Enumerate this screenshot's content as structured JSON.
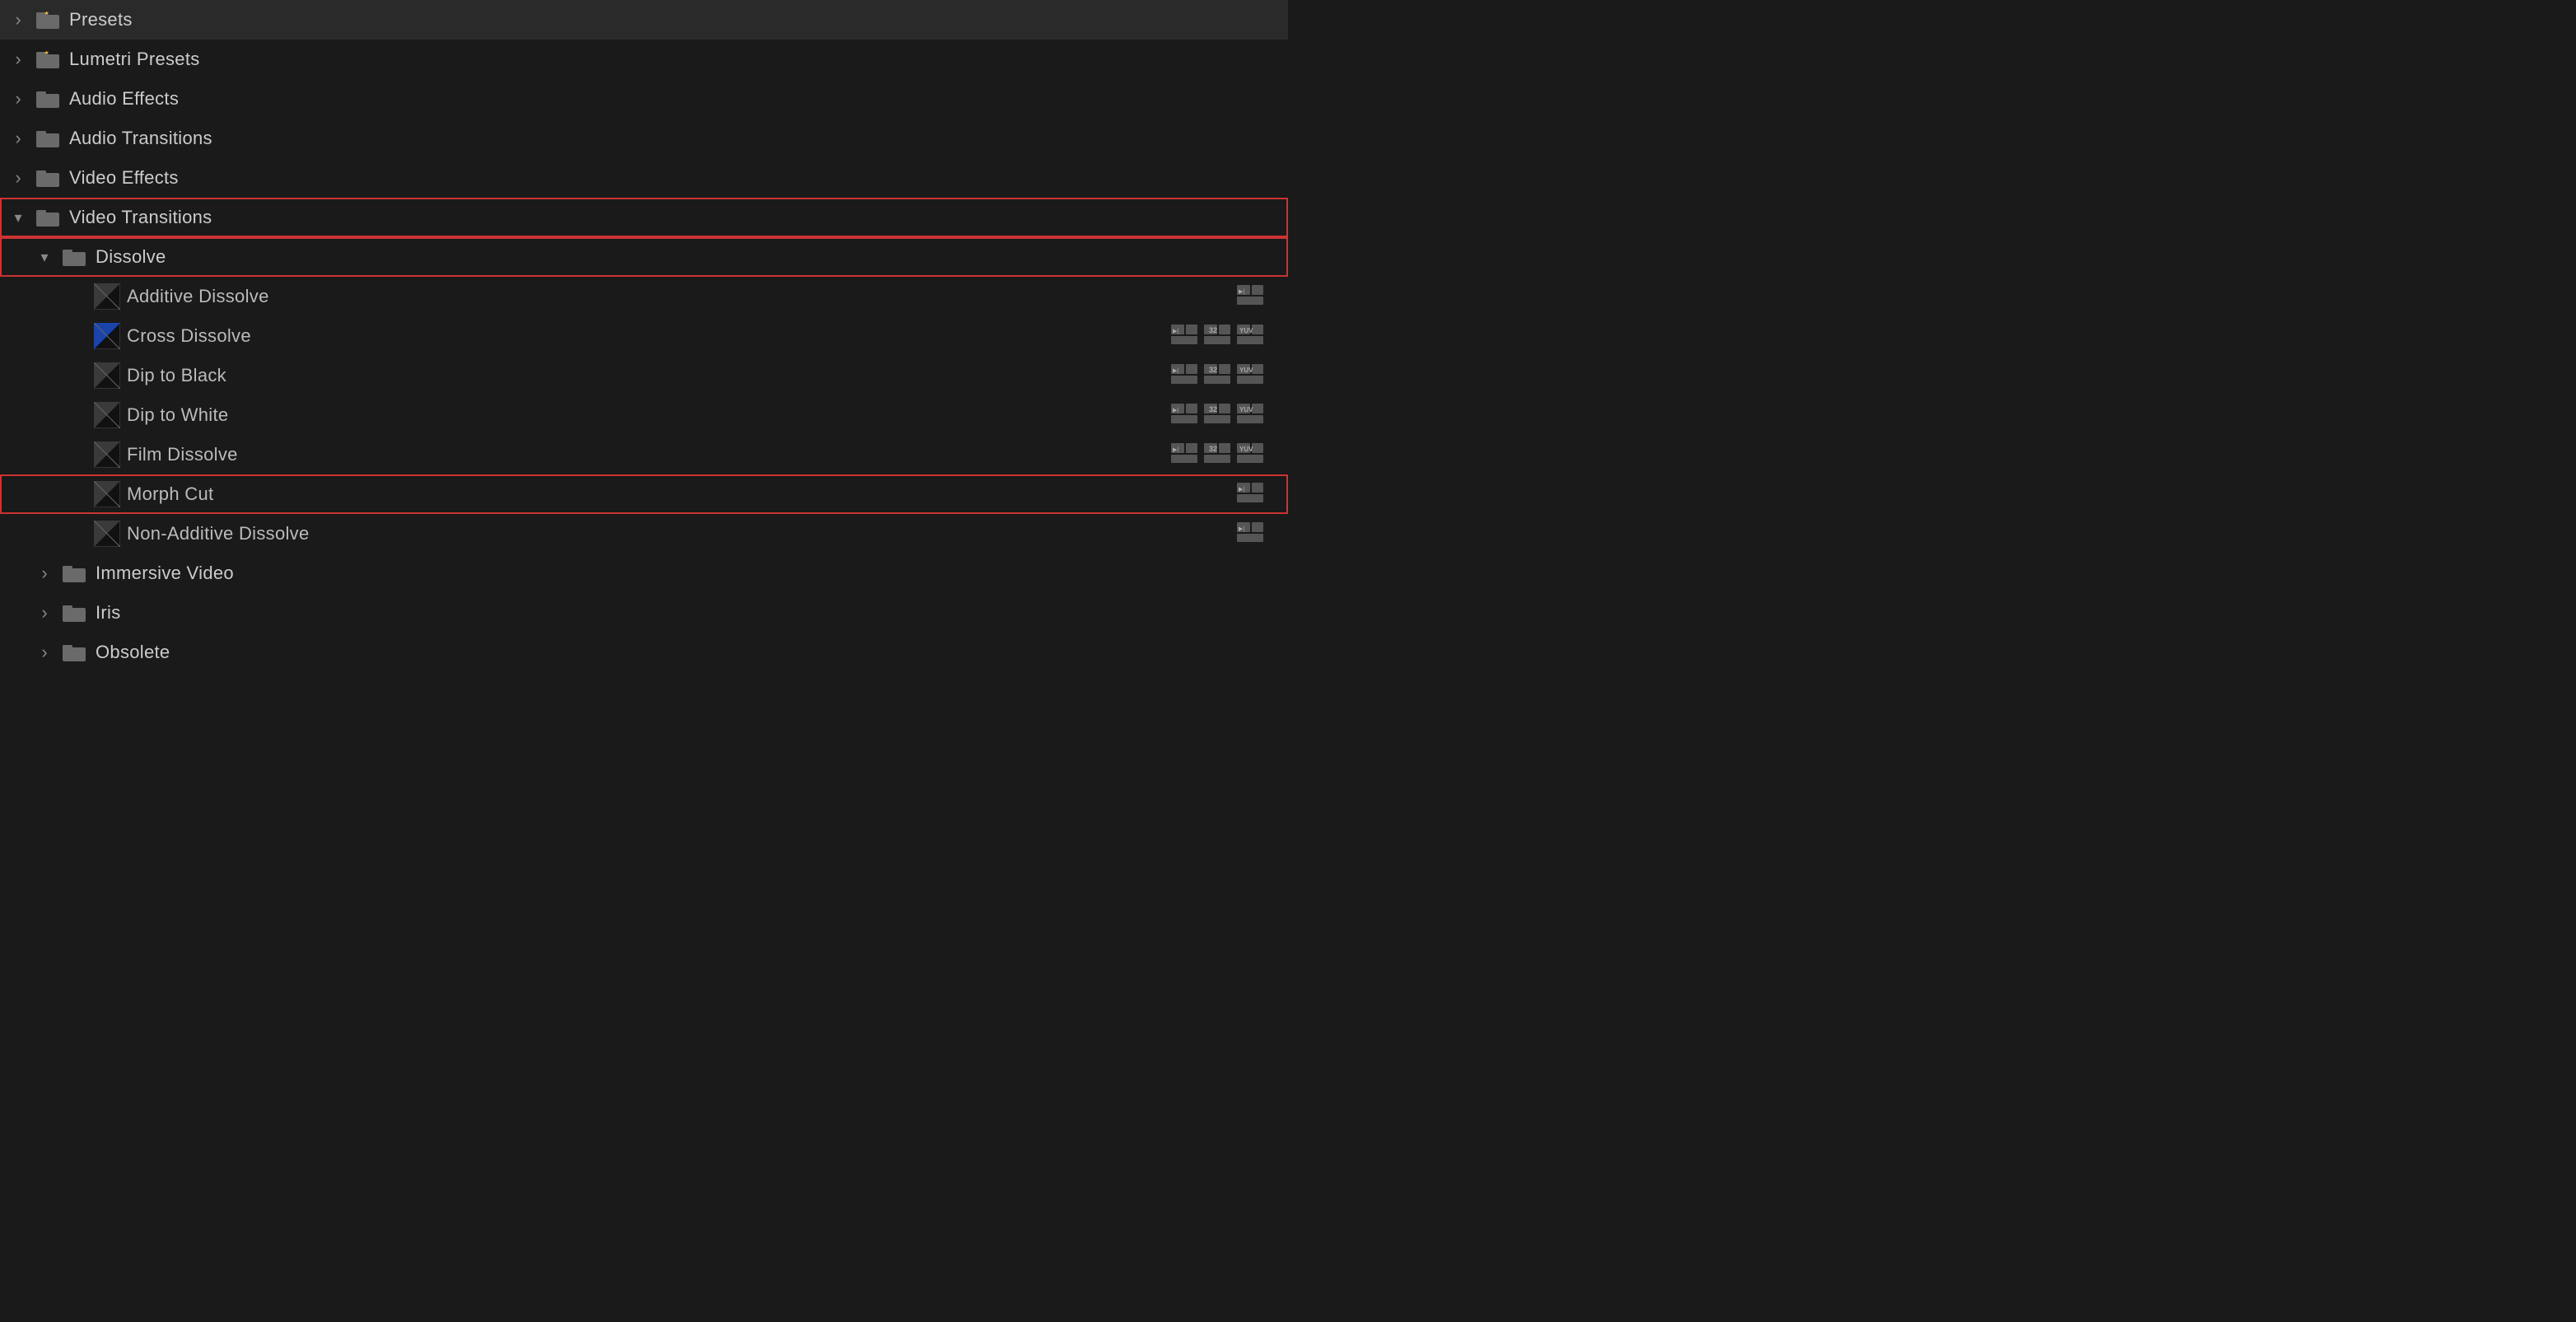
{
  "panel": {
    "items": [
      {
        "id": "presets",
        "label": "Presets",
        "type": "folder",
        "indent": 0,
        "chevron": "collapsed",
        "hasStarIcon": true,
        "highlighted": false,
        "badges": []
      },
      {
        "id": "lumetri-presets",
        "label": "Lumetri Presets",
        "type": "folder",
        "indent": 0,
        "chevron": "collapsed",
        "hasStarIcon": true,
        "highlighted": false,
        "badges": []
      },
      {
        "id": "audio-effects",
        "label": "Audio Effects",
        "type": "folder",
        "indent": 0,
        "chevron": "collapsed",
        "hasStarIcon": false,
        "highlighted": false,
        "badges": []
      },
      {
        "id": "audio-transitions",
        "label": "Audio Transitions",
        "type": "folder",
        "indent": 0,
        "chevron": "collapsed",
        "hasStarIcon": false,
        "highlighted": false,
        "badges": []
      },
      {
        "id": "video-effects",
        "label": "Video Effects",
        "type": "folder",
        "indent": 0,
        "chevron": "collapsed",
        "hasStarIcon": false,
        "highlighted": false,
        "badges": []
      },
      {
        "id": "video-transitions",
        "label": "Video Transitions",
        "type": "folder",
        "indent": 0,
        "chevron": "expanded",
        "hasStarIcon": false,
        "highlighted": true,
        "badges": []
      },
      {
        "id": "dissolve",
        "label": "Dissolve",
        "type": "folder",
        "indent": 1,
        "chevron": "expanded",
        "hasStarIcon": false,
        "highlighted": true,
        "badges": [],
        "showCursor": true
      },
      {
        "id": "additive-dissolve",
        "label": "Additive Dissolve",
        "type": "transition",
        "iconStyle": "dark",
        "indent": 2,
        "chevron": "none",
        "highlighted": false,
        "badges": [
          "accelerated"
        ]
      },
      {
        "id": "cross-dissolve",
        "label": "Cross Dissolve",
        "type": "transition",
        "iconStyle": "blue",
        "indent": 2,
        "chevron": "none",
        "highlighted": false,
        "badges": [
          "accelerated",
          "32bit",
          "yuv"
        ]
      },
      {
        "id": "dip-to-black",
        "label": "Dip to Black",
        "type": "transition",
        "iconStyle": "dark",
        "indent": 2,
        "chevron": "none",
        "highlighted": false,
        "badges": [
          "accelerated",
          "32bit",
          "yuv"
        ]
      },
      {
        "id": "dip-to-white",
        "label": "Dip to White",
        "type": "transition",
        "iconStyle": "dark",
        "indent": 2,
        "chevron": "none",
        "highlighted": false,
        "badges": [
          "accelerated",
          "32bit",
          "yuv"
        ]
      },
      {
        "id": "film-dissolve",
        "label": "Film Dissolve",
        "type": "transition",
        "iconStyle": "dark",
        "indent": 2,
        "chevron": "none",
        "highlighted": false,
        "badges": [
          "accelerated",
          "32bit",
          "yuv"
        ]
      },
      {
        "id": "morph-cut",
        "label": "Morph Cut",
        "type": "transition",
        "iconStyle": "dark",
        "indent": 2,
        "chevron": "none",
        "highlighted": true,
        "badges": [
          "accelerated"
        ]
      },
      {
        "id": "non-additive-dissolve",
        "label": "Non-Additive Dissolve",
        "type": "transition",
        "iconStyle": "dark",
        "indent": 2,
        "chevron": "none",
        "highlighted": false,
        "badges": [
          "accelerated"
        ]
      },
      {
        "id": "immersive-video",
        "label": "Immersive Video",
        "type": "folder",
        "indent": 1,
        "chevron": "collapsed",
        "hasStarIcon": false,
        "highlighted": false,
        "badges": []
      },
      {
        "id": "iris",
        "label": "Iris",
        "type": "folder",
        "indent": 1,
        "chevron": "collapsed",
        "hasStarIcon": false,
        "highlighted": false,
        "badges": []
      },
      {
        "id": "obsolete",
        "label": "Obsolete",
        "type": "folder",
        "indent": 1,
        "chevron": "collapsed",
        "hasStarIcon": false,
        "highlighted": false,
        "badges": []
      }
    ],
    "badge_labels": {
      "accelerated": "⚡",
      "32bit": "32",
      "yuv": "YUV"
    }
  }
}
